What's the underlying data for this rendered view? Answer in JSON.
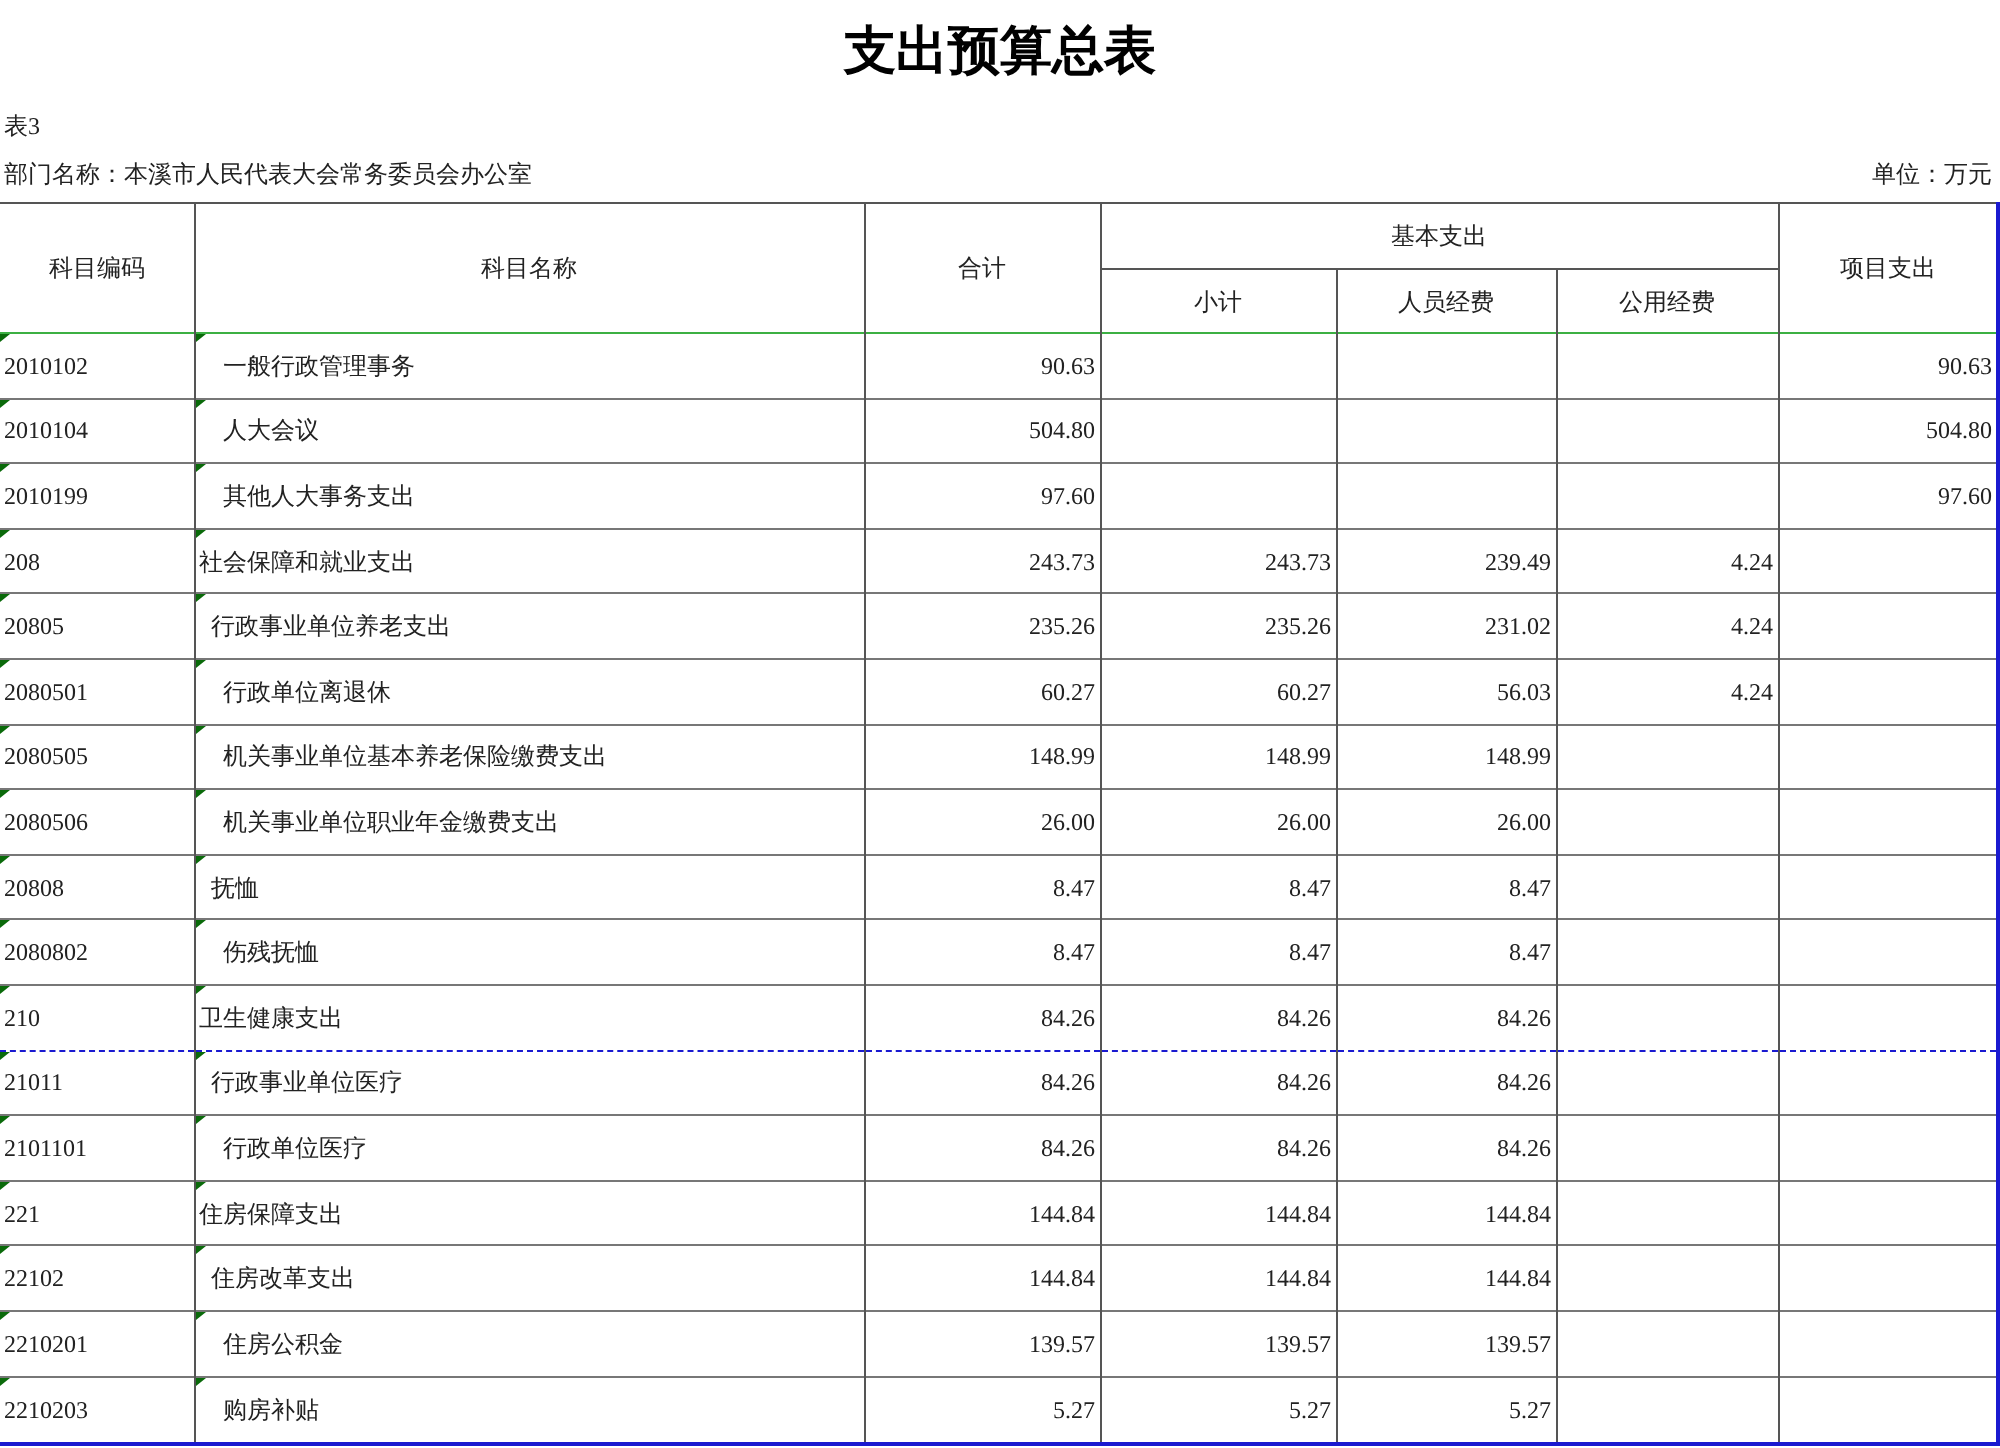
{
  "title": "支出预算总表",
  "table_no": "表3",
  "department": "部门名称：本溪市人民代表大会常务委员会办公室",
  "unit": "单位：万元",
  "columns": {
    "code": "科目编码",
    "name": "科目名称",
    "total": "合计",
    "basic": "基本支出",
    "subtotal": "小计",
    "personnel": "人员经费",
    "public": "公用经费",
    "project": "项目支出"
  },
  "rows": [
    {
      "kind": "item",
      "code": "2010102",
      "name": "一般行政管理事务",
      "total": "90.63",
      "project": "90.63",
      "page_break_before": false
    },
    {
      "kind": "item",
      "code": "2010104",
      "name": "人大会议",
      "total": "504.80",
      "project": "504.80",
      "page_break_before": false
    },
    {
      "kind": "item",
      "code": "2010199",
      "name": "其他人大事务支出",
      "total": "97.60",
      "project": "97.60",
      "page_break_before": false
    },
    {
      "kind": "category",
      "code": "208",
      "name": "社会保障和就业支出",
      "total": "243.73",
      "subtotal": "243.73",
      "personnel": "239.49",
      "public": "4.24",
      "page_break_before": false
    },
    {
      "kind": "section",
      "code": "20805",
      "name": "行政事业单位养老支出",
      "total": "235.26",
      "subtotal": "235.26",
      "personnel": "231.02",
      "public": "4.24",
      "page_break_before": false
    },
    {
      "kind": "item",
      "code": "2080501",
      "name": "行政单位离退休",
      "total": "60.27",
      "subtotal": "60.27",
      "personnel": "56.03",
      "public": "4.24",
      "page_break_before": false
    },
    {
      "kind": "item",
      "code": "2080505",
      "name": "机关事业单位基本养老保险缴费支出",
      "total": "148.99",
      "subtotal": "148.99",
      "personnel": "148.99",
      "page_break_before": false
    },
    {
      "kind": "item",
      "code": "2080506",
      "name": "机关事业单位职业年金缴费支出",
      "total": "26.00",
      "subtotal": "26.00",
      "personnel": "26.00",
      "page_break_before": false
    },
    {
      "kind": "section",
      "code": "20808",
      "name": "抚恤",
      "total": "8.47",
      "subtotal": "8.47",
      "personnel": "8.47",
      "page_break_before": false
    },
    {
      "kind": "item",
      "code": "2080802",
      "name": "伤残抚恤",
      "total": "8.47",
      "subtotal": "8.47",
      "personnel": "8.47",
      "page_break_before": false
    },
    {
      "kind": "category",
      "code": "210",
      "name": "卫生健康支出",
      "total": "84.26",
      "subtotal": "84.26",
      "personnel": "84.26",
      "page_break_before": false
    },
    {
      "kind": "section",
      "code": "21011",
      "name": "行政事业单位医疗",
      "total": "84.26",
      "subtotal": "84.26",
      "personnel": "84.26",
      "page_break_before": true
    },
    {
      "kind": "item",
      "code": "2101101",
      "name": "行政单位医疗",
      "total": "84.26",
      "subtotal": "84.26",
      "personnel": "84.26",
      "page_break_before": false
    },
    {
      "kind": "category",
      "code": "221",
      "name": "住房保障支出",
      "total": "144.84",
      "subtotal": "144.84",
      "personnel": "144.84",
      "page_break_before": false
    },
    {
      "kind": "section",
      "code": "22102",
      "name": "住房改革支出",
      "total": "144.84",
      "subtotal": "144.84",
      "personnel": "144.84",
      "page_break_before": false
    },
    {
      "kind": "item",
      "code": "2210201",
      "name": "住房公积金",
      "total": "139.57",
      "subtotal": "139.57",
      "personnel": "139.57",
      "page_break_before": false
    },
    {
      "kind": "item",
      "code": "2210203",
      "name": "购房补贴",
      "total": "5.27",
      "subtotal": "5.27",
      "personnel": "5.27",
      "page_break_before": false
    }
  ]
}
